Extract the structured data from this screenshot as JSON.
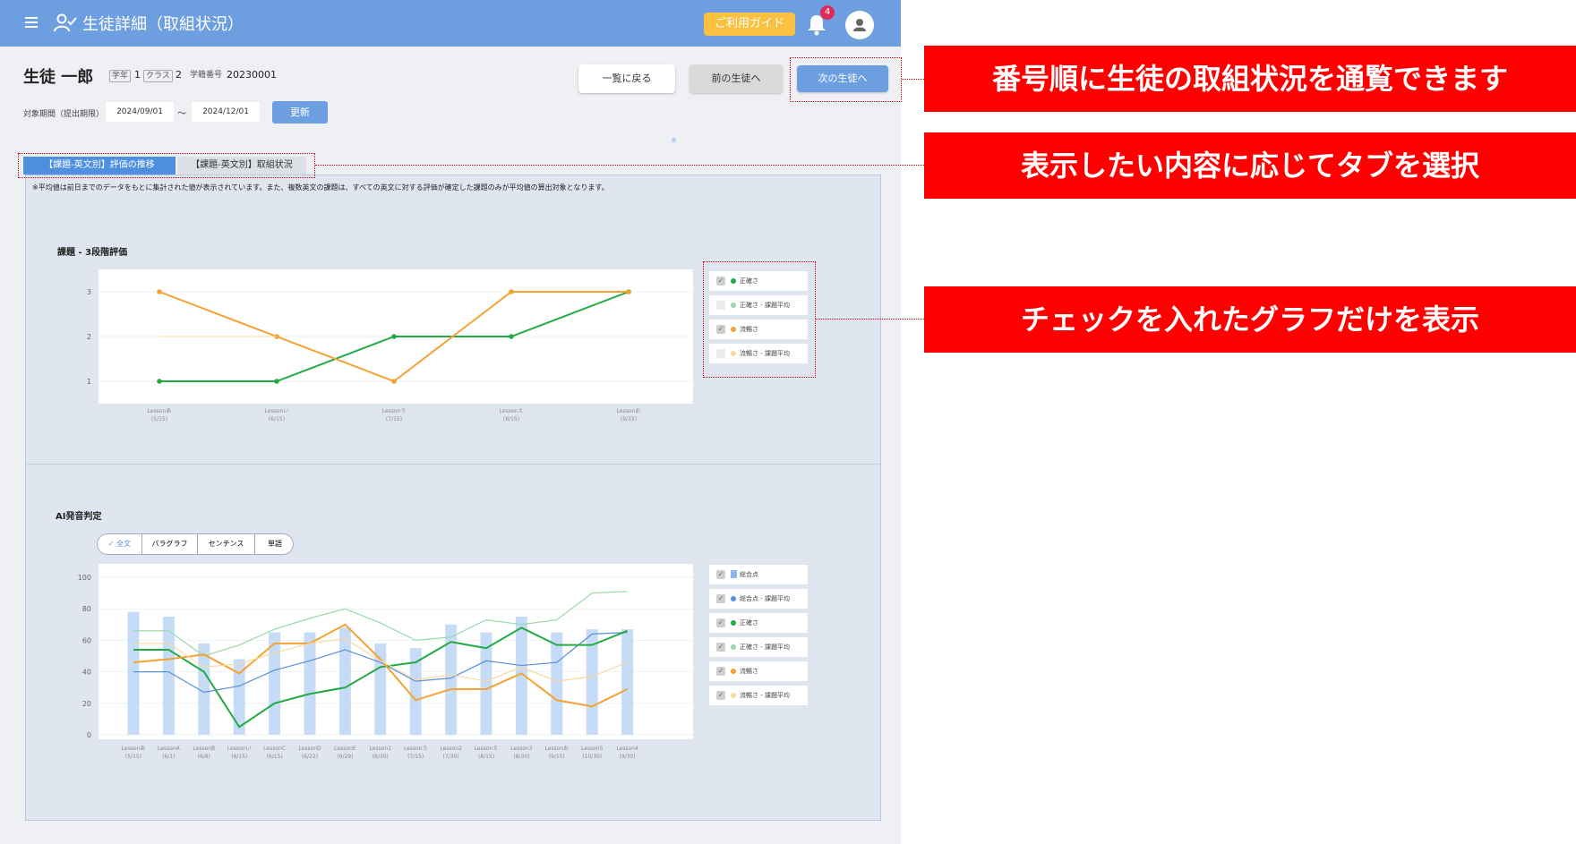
{
  "header": {
    "title": "生徒詳細（取組状況）",
    "guide_label": "ご利用ガイド",
    "notification_count": "4"
  },
  "student": {
    "name": "生徒 一郎",
    "grade_label": "学年",
    "grade": "1",
    "class_label": "クラス",
    "class": "2",
    "id_label": "学籍番号",
    "id": "20230001"
  },
  "nav": {
    "back_label": "一覧に戻る",
    "prev_label": "前の生徒へ",
    "next_label": "次の生徒へ"
  },
  "period": {
    "label": "対象期間（提出期限）",
    "from": "2024/09/01",
    "tilde": "〜",
    "to": "2024/12/01",
    "update_label": "更新"
  },
  "tabs": [
    {
      "label": "【課題-英文別】評価の推移"
    },
    {
      "label": "【課題-英文別】取組状況"
    }
  ],
  "note": "※平均値は前日までのデータをもとに集計された値が表示されています。また、複数英文の課題は、すべての英文に対する評価が確定した課題のみが平均値の算出対象となります。",
  "chart1": {
    "title": "課題 - 3段階評価",
    "legend": [
      {
        "label": "正確さ",
        "checked": true,
        "color": "#22aa44"
      },
      {
        "label": "正確さ - 課題平均",
        "checked": false,
        "color": "#9ad8a8"
      },
      {
        "label": "流暢さ",
        "checked": true,
        "color": "#f5a233"
      },
      {
        "label": "流暢さ - 課題平均",
        "checked": false,
        "color": "#f8d9a0"
      }
    ]
  },
  "chart2": {
    "title": "AI発音判定",
    "segments": [
      "全文",
      "パラグラフ",
      "センテンス",
      "単語"
    ],
    "legend": [
      {
        "label": "総合点",
        "checked": true,
        "color": "#8fb8ea"
      },
      {
        "label": "総合点 - 課題平均",
        "checked": true,
        "color": "#5b8fd8"
      },
      {
        "label": "正確さ",
        "checked": true,
        "color": "#22aa44"
      },
      {
        "label": "正確さ - 課題平均",
        "checked": true,
        "color": "#9ad8a8"
      },
      {
        "label": "流暢さ",
        "checked": true,
        "color": "#f5a233"
      },
      {
        "label": "流暢さ - 課題平均",
        "checked": true,
        "color": "#f8d9a0"
      }
    ]
  },
  "callouts": {
    "nav": "番号順に生徒の取組状況を通覧できます",
    "tabs": "表示したい内容に応じてタブを選択",
    "legend": "チェックを入れたグラフだけを表示"
  },
  "chart_data": [
    {
      "type": "line",
      "title": "課題 - 3段階評価",
      "categories": [
        {
          "name": "Lessonあ",
          "date": "(5/15)"
        },
        {
          "name": "Lessonい",
          "date": "(6/15)"
        },
        {
          "name": "Lessonう",
          "date": "(7/15)"
        },
        {
          "name": "Lessonえ",
          "date": "(8/15)"
        },
        {
          "name": "Lessonお",
          "date": "(9/15)"
        }
      ],
      "ylim": [
        1,
        3
      ],
      "yticks": [
        1,
        2,
        3
      ],
      "series": [
        {
          "name": "正確さ",
          "color": "#22aa44",
          "values": [
            1,
            1,
            2,
            2,
            3
          ]
        },
        {
          "name": "流暢さ",
          "color": "#f5a233",
          "values": [
            3,
            2,
            1,
            3,
            3
          ]
        },
        {
          "name": "流暢さ - 課題平均",
          "color": "#f8d9a0",
          "values": [
            2,
            2,
            null,
            null,
            null
          ]
        }
      ]
    },
    {
      "type": "bar",
      "title": "AI発音判定",
      "categories": [
        {
          "name": "Lessonあ",
          "date": "(5/15)"
        },
        {
          "name": "LessonA",
          "date": "(6/1)"
        },
        {
          "name": "LessonB",
          "date": "(6/8)"
        },
        {
          "name": "Lessonい",
          "date": "(6/15)"
        },
        {
          "name": "LessonC",
          "date": "(6/15)"
        },
        {
          "name": "LessonD",
          "date": "(6/22)"
        },
        {
          "name": "LessonE",
          "date": "(6/29)"
        },
        {
          "name": "Lesson1",
          "date": "(6/30)"
        },
        {
          "name": "Lessonう",
          "date": "(7/15)"
        },
        {
          "name": "Lesson2",
          "date": "(7/30)"
        },
        {
          "name": "Lessonえ",
          "date": "(8/15)"
        },
        {
          "name": "Lesson3",
          "date": "(8/30)"
        },
        {
          "name": "Lessonお",
          "date": "(9/15)"
        },
        {
          "name": "Lesson5",
          "date": "(10/30)"
        },
        {
          "name": "Lesson4",
          "date": "(9/30)"
        }
      ],
      "ylim": [
        0,
        100
      ],
      "yticks": [
        0,
        20,
        40,
        60,
        80,
        100
      ],
      "bars": {
        "name": "総合点",
        "color": "#c6dcf6",
        "values": [
          78,
          75,
          58,
          48,
          65,
          65,
          68,
          58,
          55,
          70,
          65,
          75,
          65,
          67,
          67
        ]
      },
      "series": [
        {
          "name": "総合点 - 課題平均",
          "color": "#5b8fd8",
          "values": [
            40,
            40,
            27,
            31,
            41,
            47,
            54,
            46,
            34,
            36,
            47,
            44,
            46,
            64,
            65
          ]
        },
        {
          "name": "正確さ",
          "color": "#22aa44",
          "values": [
            54,
            54,
            40,
            5,
            20,
            26,
            30,
            43,
            46,
            59,
            55,
            68,
            57,
            57,
            66
          ]
        },
        {
          "name": "正確さ - 課題平均",
          "color": "#9ad8a8",
          "values": [
            66,
            66,
            50,
            57,
            67,
            74,
            80,
            71,
            60,
            62,
            73,
            70,
            73,
            90,
            91
          ]
        },
        {
          "name": "流暢さ",
          "color": "#f5a233",
          "values": [
            46,
            48,
            51,
            39,
            58,
            58,
            70,
            48,
            22,
            29,
            29,
            39,
            22,
            18,
            29
          ]
        },
        {
          "name": "流暢さ - 課題平均",
          "color": "#f8d9a0",
          "values": [
            58,
            58,
            43,
            45,
            52,
            58,
            61,
            47,
            35,
            38,
            34,
            43,
            34,
            37,
            46
          ]
        }
      ]
    }
  ]
}
